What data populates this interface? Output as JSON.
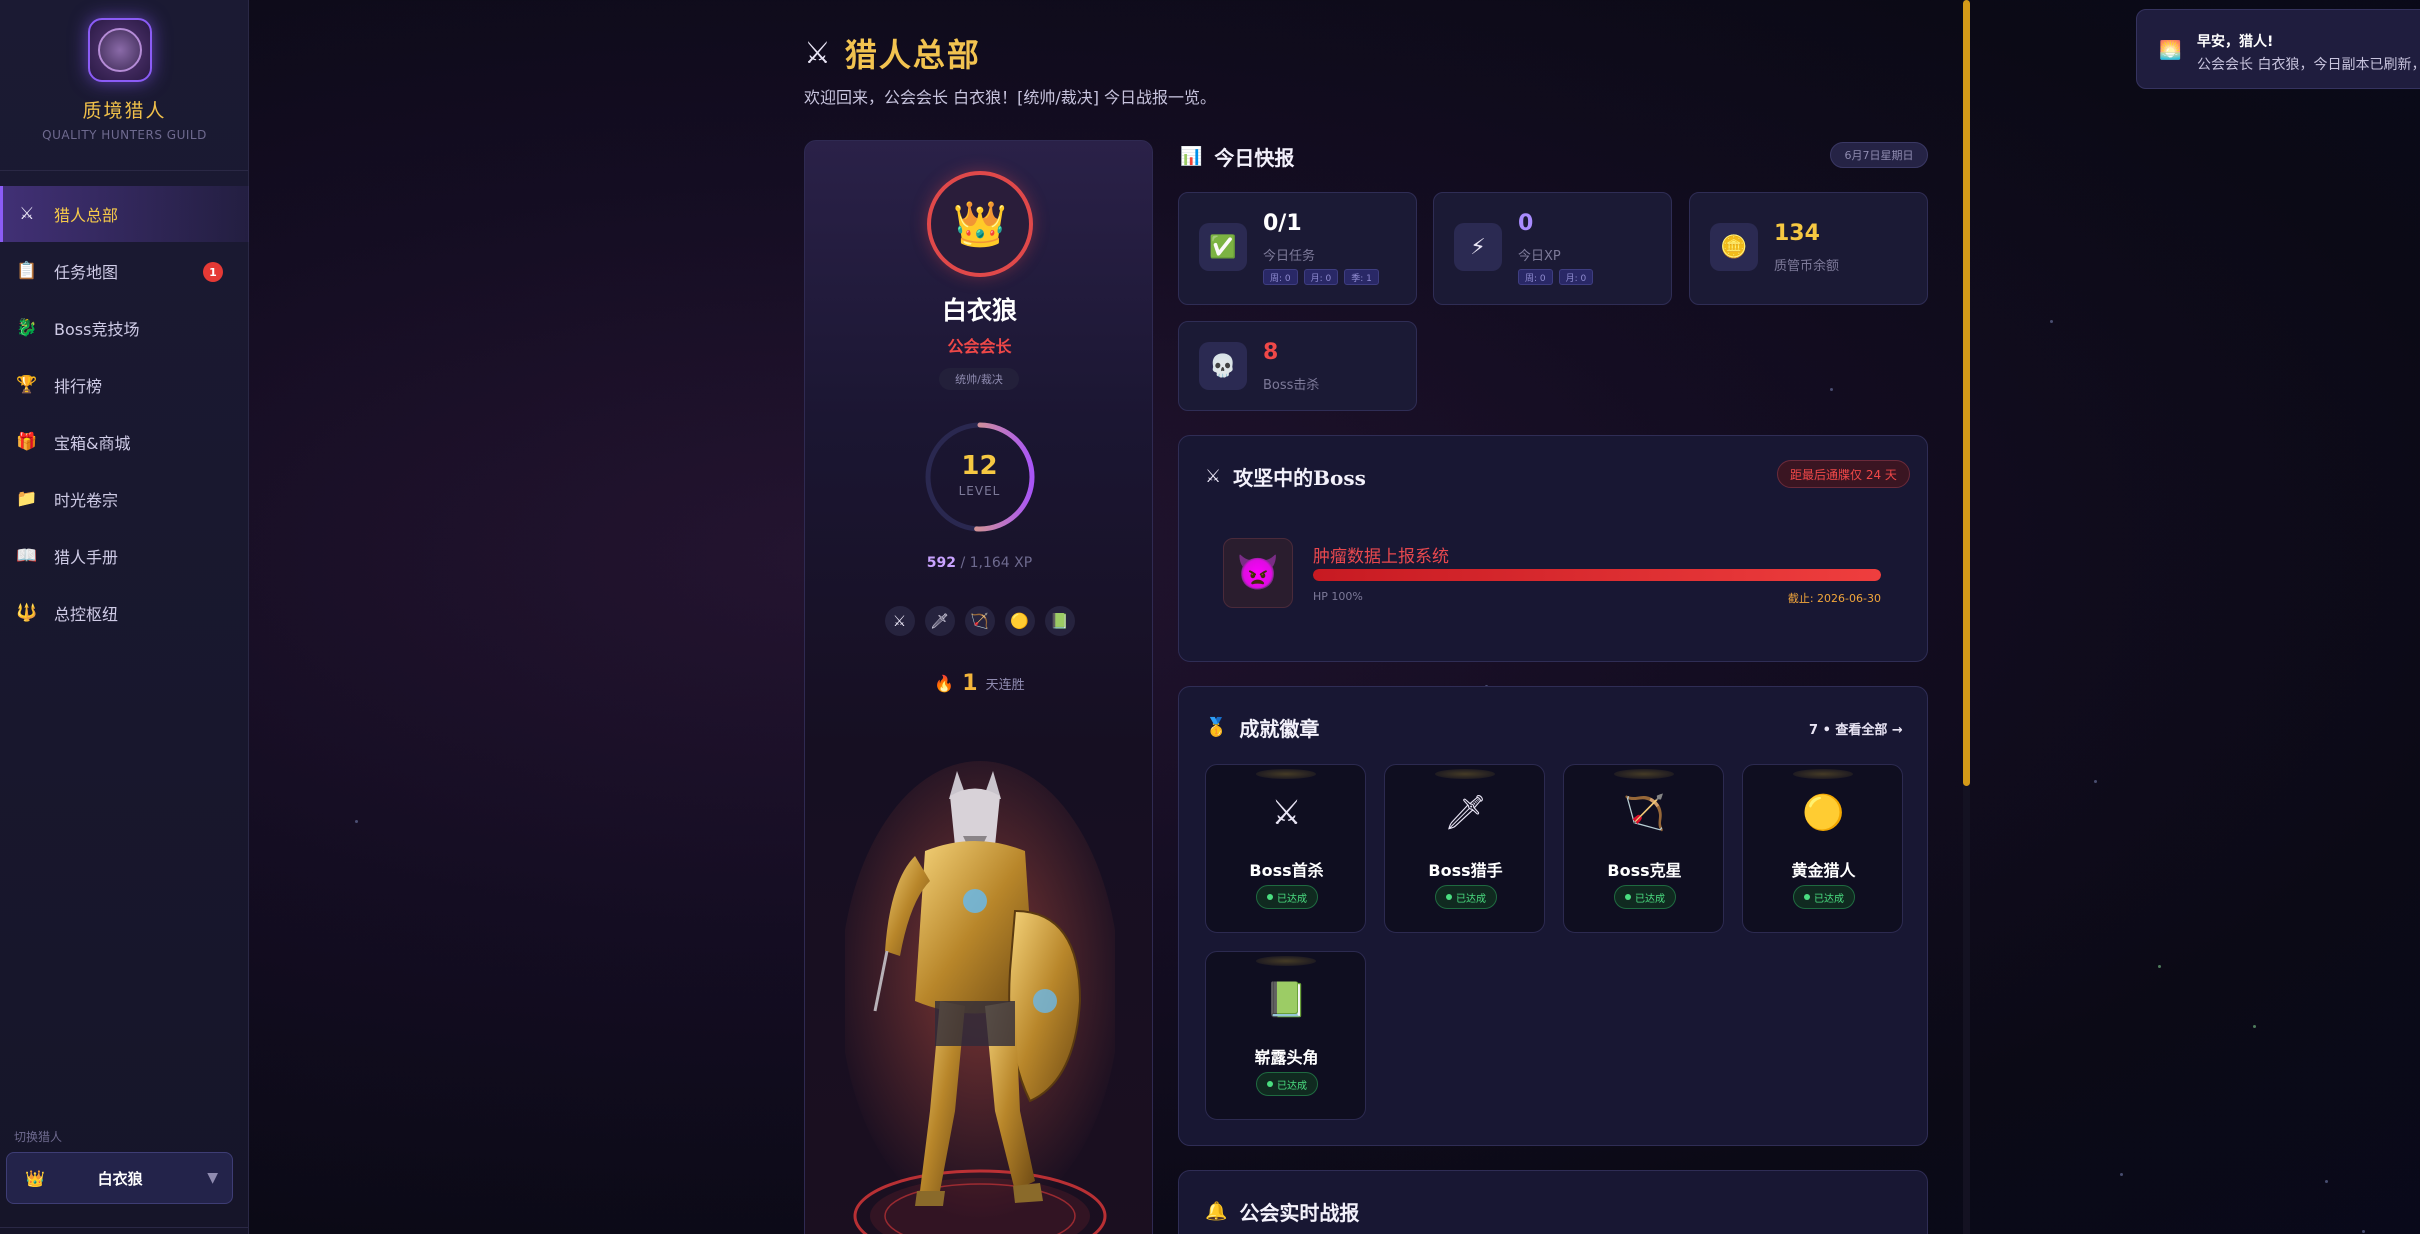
{
  "sidebar": {
    "brand_title": "质境猎人",
    "brand_subtitle": "QUALITY HUNTERS GUILD",
    "items": [
      {
        "label": "猎人总部",
        "icon": "⚔",
        "icon_name": "crossed-swords-icon",
        "active": true
      },
      {
        "label": "任务地图",
        "icon": "📋",
        "icon_name": "clipboard-icon",
        "badge": "1"
      },
      {
        "label": "Boss竞技场",
        "icon": "🐉",
        "icon_name": "dragon-icon"
      },
      {
        "label": "排行榜",
        "icon": "🏆",
        "icon_name": "trophy-icon"
      },
      {
        "label": "宝箱&商城",
        "icon": "🎁",
        "icon_name": "gift-icon"
      },
      {
        "label": "时光卷宗",
        "icon": "📁",
        "icon_name": "folder-icon"
      },
      {
        "label": "猎人手册",
        "icon": "📖",
        "icon_name": "book-icon"
      },
      {
        "label": "总控枢纽",
        "icon": "🔱",
        "icon_name": "trident-icon"
      }
    ],
    "switch_label": "切换猎人",
    "switch_value": "白衣狼"
  },
  "header": {
    "icon": "⚔",
    "title": "猎人总部",
    "welcome": "欢迎回来，公会会长 白衣狼！[统帅/裁决] 今日战报一览。"
  },
  "profile": {
    "avatar_icon": "👑",
    "name": "白衣狼",
    "role": "公会会长",
    "tag": "统帅/裁决",
    "level": "12",
    "level_label": "LEVEL",
    "level_progress": 0.51,
    "xp_current": "592",
    "xp_total": " / 1,164 XP",
    "badges": [
      "⚔",
      "🗡",
      "🏹",
      "🟡",
      "📗"
    ],
    "streak_icon": "🔥",
    "streak_num": "1",
    "streak_label": "天连胜"
  },
  "daily": {
    "icon": "📊",
    "title": "今日快报",
    "date": "6月7日星期日",
    "stats": [
      {
        "icon": "✅",
        "icon_name": "check-icon",
        "value": "0/1",
        "label": "今日任务",
        "color": "#ffffff",
        "chips": [
          "周: 0",
          "月: 0",
          "季: 1"
        ]
      },
      {
        "icon": "⚡",
        "icon_name": "lightning-icon",
        "value": "0",
        "label": "今日XP",
        "color": "#a98cff",
        "chips": [
          "周: 0",
          "月: 0"
        ]
      },
      {
        "icon": "🪙",
        "icon_name": "coin-icon",
        "value": "134",
        "label": "质管币余额",
        "color": "#f6c842",
        "chips": []
      },
      {
        "icon": "💀",
        "icon_name": "skull-icon",
        "value": "8",
        "label": "Boss击杀",
        "color": "#ef4848",
        "chips": []
      }
    ]
  },
  "boss_panel": {
    "icon": "⚔",
    "title": "攻坚中的Boss",
    "pill": "距最后通牒仅 24 天",
    "boss_icon": "👿",
    "boss_name": "肿瘤数据上报系统",
    "hp_percent": 100,
    "hp_label": "HP 100%",
    "deadline": "截止: 2026-06-30"
  },
  "achievements": {
    "icon": "🥇",
    "title": "成就徽章",
    "view_all": "7 • 查看全部 →",
    "items": [
      {
        "icon": "⚔",
        "name": "Boss首杀",
        "status": "已达成"
      },
      {
        "icon": "🗡",
        "name": "Boss猎手",
        "status": "已达成"
      },
      {
        "icon": "🏹",
        "name": "Boss克星",
        "status": "已达成"
      },
      {
        "icon": "🟡",
        "name": "黄金猎人",
        "status": "已达成"
      },
      {
        "icon": "📗",
        "name": "崭露头角",
        "status": "已达成"
      }
    ]
  },
  "guild_panel": {
    "icon": "🔔",
    "title": "公会实时战报"
  },
  "toast": {
    "icon": "🌅",
    "title": "早安，猎人!",
    "message": "公会会长 白衣狼，今日副本已刷新，"
  },
  "colors": {
    "accent": "#8b5cf6",
    "gold": "#f2c350",
    "danger": "#ef4848",
    "success": "#4ade80"
  }
}
